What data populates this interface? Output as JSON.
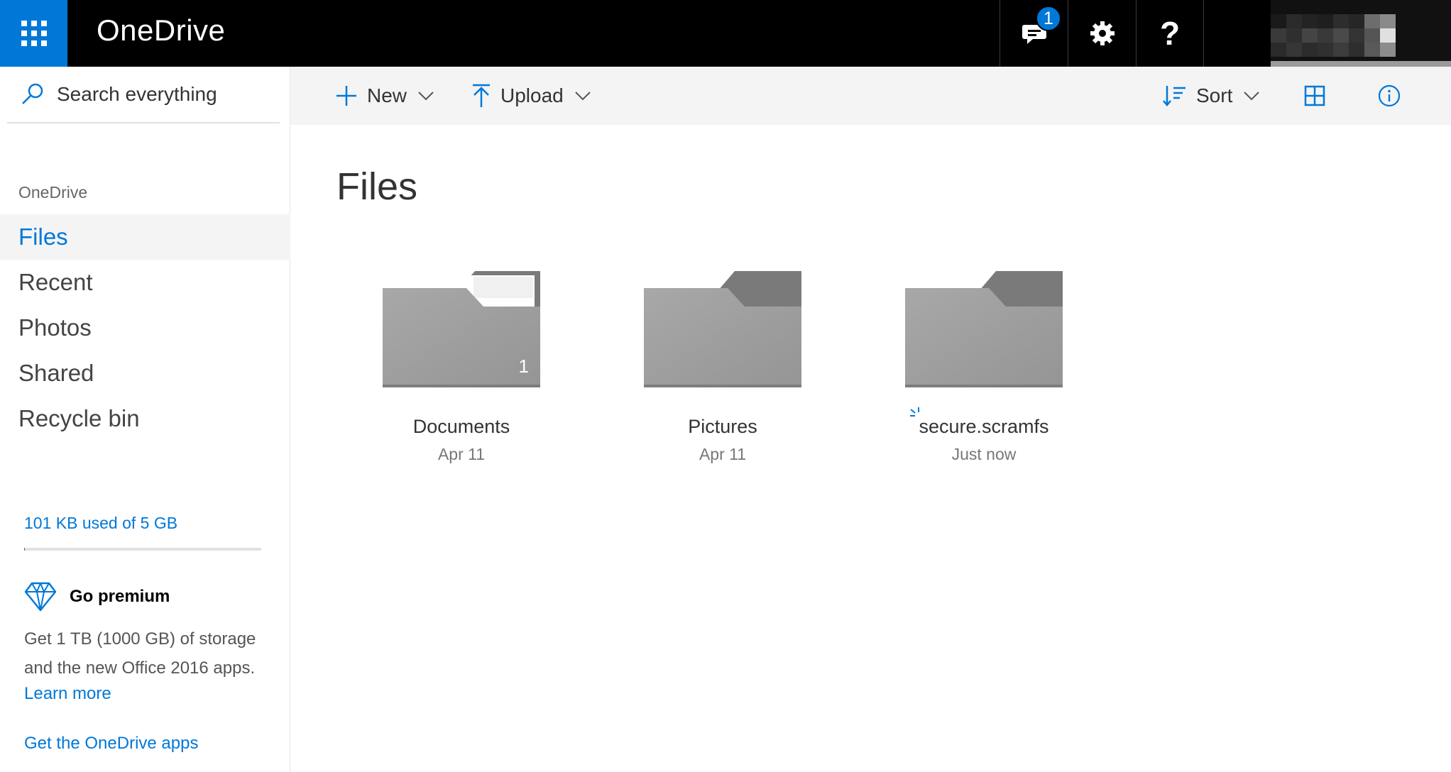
{
  "header": {
    "app_name": "OneDrive",
    "notification_count": "1",
    "help_label": "?"
  },
  "sidebar": {
    "search_label": "Search everything",
    "section_heading": "OneDrive",
    "items": [
      {
        "label": "Files",
        "active": true
      },
      {
        "label": "Recent",
        "active": false
      },
      {
        "label": "Photos",
        "active": false
      },
      {
        "label": "Shared",
        "active": false
      },
      {
        "label": "Recycle bin",
        "active": false
      }
    ],
    "storage": {
      "text": "101 KB used of 5 GB",
      "used_fraction": 2e-05
    },
    "premium": {
      "title": "Go premium",
      "description": "Get 1 TB (1000 GB) of storage and the new Office 2016 apps.",
      "learn_more": "Learn more"
    },
    "get_apps": "Get the OneDrive apps"
  },
  "toolbar": {
    "new_label": "New",
    "upload_label": "Upload",
    "sort_label": "Sort"
  },
  "main": {
    "title": "Files",
    "folders": [
      {
        "name": "Documents",
        "date": "Apr 11",
        "count": "1",
        "has_content": true
      },
      {
        "name": "Pictures",
        "date": "Apr 11",
        "count": "",
        "has_content": false
      },
      {
        "name": "secure.scramfs",
        "date": "Just now",
        "count": "",
        "has_content": false,
        "syncing": true
      }
    ]
  },
  "colors": {
    "accent": "#0078d7",
    "topbar": "#000000",
    "folder_body": "#a3a3a3",
    "folder_tab": "#7a7a7a"
  }
}
